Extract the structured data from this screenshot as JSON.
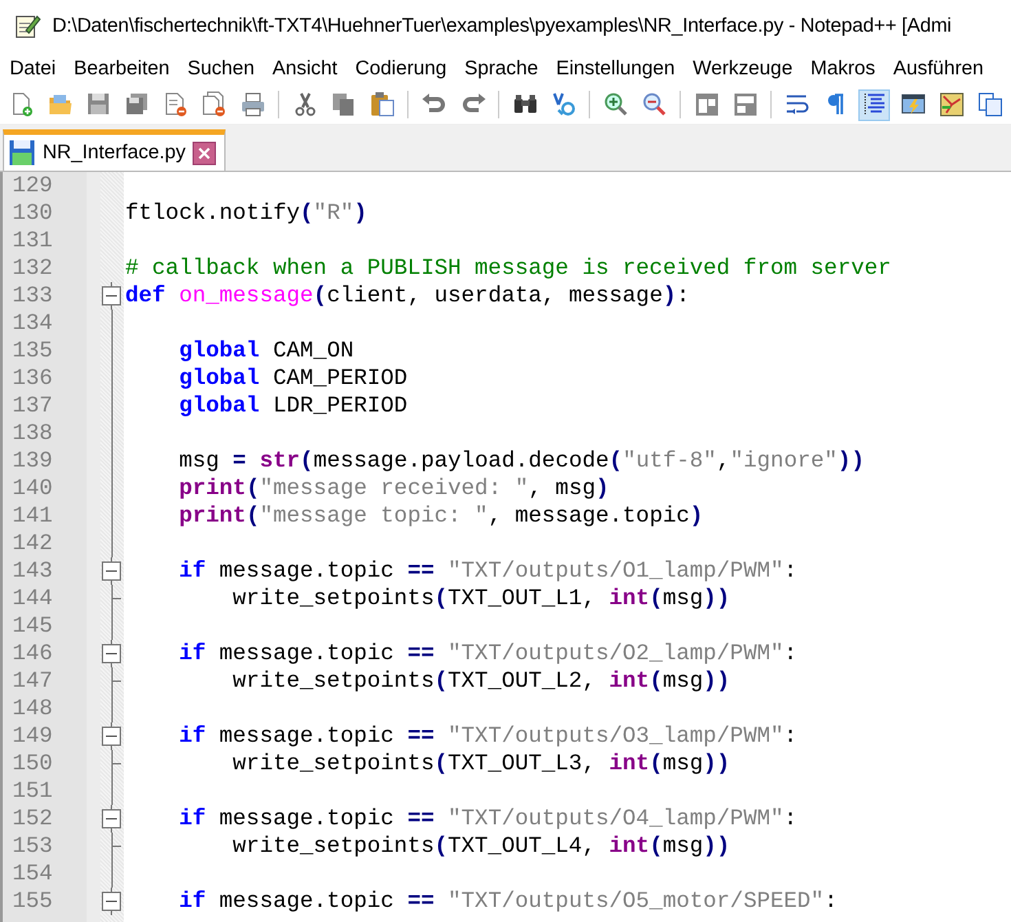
{
  "window": {
    "title": "D:\\Daten\\fischertechnik\\ft-TXT4\\HuehnerTuer\\examples\\pyexamples\\NR_Interface.py - Notepad++ [Admi"
  },
  "menu": [
    {
      "label": "Datei"
    },
    {
      "label": "Bearbeiten"
    },
    {
      "label": "Suchen"
    },
    {
      "label": "Ansicht"
    },
    {
      "label": "Codierung"
    },
    {
      "label": "Sprache"
    },
    {
      "label": "Einstellungen"
    },
    {
      "label": "Werkzeuge"
    },
    {
      "label": "Makros"
    },
    {
      "label": "Ausführen"
    }
  ],
  "tabs": [
    {
      "label": "NR_Interface.py",
      "selected": true
    }
  ],
  "editor": {
    "lines": [
      {
        "number": "129",
        "kind": "plain"
      },
      {
        "number": "130",
        "kind": "plain",
        "tokens": [
          {
            "kind": "text",
            "text": "ftlock.notify"
          },
          {
            "kind": "op",
            "text": "("
          },
          {
            "kind": "str",
            "text": "\"R\""
          },
          {
            "kind": "op",
            "text": ")"
          }
        ]
      },
      {
        "number": "131",
        "kind": "plain"
      },
      {
        "number": "132",
        "kind": "plain",
        "tokens": [
          {
            "kind": "comment",
            "text": "# callback when a PUBLISH message is received from server"
          }
        ]
      },
      {
        "number": "133",
        "kind": "foldstart",
        "tokens": [
          {
            "kind": "kw",
            "text": "def"
          },
          {
            "kind": "fn",
            "text": " on_message"
          },
          {
            "kind": "op",
            "text": "("
          },
          {
            "kind": "text",
            "text": "client, userdata, message"
          },
          {
            "kind": "op",
            "text": ")"
          },
          {
            "kind": "text",
            "text": ":"
          }
        ]
      },
      {
        "number": "134",
        "kind": "foldbody"
      },
      {
        "number": "135",
        "kind": "foldbody",
        "tokens": [
          {
            "kind": "kw",
            "text": "    global"
          },
          {
            "kind": "text",
            "text": " CAM_ON"
          }
        ]
      },
      {
        "number": "136",
        "kind": "foldbody",
        "tokens": [
          {
            "kind": "kw",
            "text": "    global"
          },
          {
            "kind": "text",
            "text": " CAM_PERIOD"
          }
        ]
      },
      {
        "number": "137",
        "kind": "foldbody",
        "tokens": [
          {
            "kind": "kw",
            "text": "    global"
          },
          {
            "kind": "text",
            "text": " LDR_PERIOD"
          }
        ]
      },
      {
        "number": "138",
        "kind": "foldbody"
      },
      {
        "number": "139",
        "kind": "foldbody",
        "tokens": [
          {
            "kind": "text",
            "text": "    msg "
          },
          {
            "kind": "op",
            "text": "="
          },
          {
            "kind": "builtin",
            "text": " str"
          },
          {
            "kind": "op",
            "text": "("
          },
          {
            "kind": "text",
            "text": "message.payload.decode"
          },
          {
            "kind": "op",
            "text": "("
          },
          {
            "kind": "str",
            "text": "\"utf-8\""
          },
          {
            "kind": "text",
            "text": ","
          },
          {
            "kind": "str",
            "text": "\"ignore\""
          },
          {
            "kind": "op",
            "text": "))"
          }
        ]
      },
      {
        "number": "140",
        "kind": "foldbody",
        "tokens": [
          {
            "kind": "builtin",
            "text": "    print"
          },
          {
            "kind": "op",
            "text": "("
          },
          {
            "kind": "str",
            "text": "\"message received: \""
          },
          {
            "kind": "text",
            "text": ", msg"
          },
          {
            "kind": "op",
            "text": ")"
          }
        ]
      },
      {
        "number": "141",
        "kind": "foldbody",
        "tokens": [
          {
            "kind": "builtin",
            "text": "    print"
          },
          {
            "kind": "op",
            "text": "("
          },
          {
            "kind": "str",
            "text": "\"message topic: \""
          },
          {
            "kind": "text",
            "text": ", message.topic"
          },
          {
            "kind": "op",
            "text": ")"
          }
        ]
      },
      {
        "number": "142",
        "kind": "foldbody"
      },
      {
        "number": "143",
        "kind": "foldstart",
        "tokens": [
          {
            "kind": "kw",
            "text": "    if"
          },
          {
            "kind": "text",
            "text": " message.topic "
          },
          {
            "kind": "op",
            "text": "=="
          },
          {
            "kind": "str",
            "text": " \"TXT/outputs/O1_lamp/PWM\""
          },
          {
            "kind": "text",
            "text": ":"
          }
        ]
      },
      {
        "number": "144",
        "kind": "foldend",
        "tokens": [
          {
            "kind": "text",
            "text": "        write_setpoints"
          },
          {
            "kind": "op",
            "text": "("
          },
          {
            "kind": "text",
            "text": "TXT_OUT_L1, "
          },
          {
            "kind": "builtin",
            "text": "int"
          },
          {
            "kind": "op",
            "text": "("
          },
          {
            "kind": "text",
            "text": "msg"
          },
          {
            "kind": "op",
            "text": "))"
          }
        ]
      },
      {
        "number": "145",
        "kind": "foldbody"
      },
      {
        "number": "146",
        "kind": "foldstart",
        "tokens": [
          {
            "kind": "kw",
            "text": "    if"
          },
          {
            "kind": "text",
            "text": " message.topic "
          },
          {
            "kind": "op",
            "text": "=="
          },
          {
            "kind": "str",
            "text": " \"TXT/outputs/O2_lamp/PWM\""
          },
          {
            "kind": "text",
            "text": ":"
          }
        ]
      },
      {
        "number": "147",
        "kind": "foldend",
        "tokens": [
          {
            "kind": "text",
            "text": "        write_setpoints"
          },
          {
            "kind": "op",
            "text": "("
          },
          {
            "kind": "text",
            "text": "TXT_OUT_L2, "
          },
          {
            "kind": "builtin",
            "text": "int"
          },
          {
            "kind": "op",
            "text": "("
          },
          {
            "kind": "text",
            "text": "msg"
          },
          {
            "kind": "op",
            "text": "))"
          }
        ]
      },
      {
        "number": "148",
        "kind": "foldbody"
      },
      {
        "number": "149",
        "kind": "foldstart",
        "tokens": [
          {
            "kind": "kw",
            "text": "    if"
          },
          {
            "kind": "text",
            "text": " message.topic "
          },
          {
            "kind": "op",
            "text": "=="
          },
          {
            "kind": "str",
            "text": " \"TXT/outputs/O3_lamp/PWM\""
          },
          {
            "kind": "text",
            "text": ":"
          }
        ]
      },
      {
        "number": "150",
        "kind": "foldend",
        "tokens": [
          {
            "kind": "text",
            "text": "        write_setpoints"
          },
          {
            "kind": "op",
            "text": "("
          },
          {
            "kind": "text",
            "text": "TXT_OUT_L3, "
          },
          {
            "kind": "builtin",
            "text": "int"
          },
          {
            "kind": "op",
            "text": "("
          },
          {
            "kind": "text",
            "text": "msg"
          },
          {
            "kind": "op",
            "text": "))"
          }
        ]
      },
      {
        "number": "151",
        "kind": "foldbody"
      },
      {
        "number": "152",
        "kind": "foldstart",
        "tokens": [
          {
            "kind": "kw",
            "text": "    if"
          },
          {
            "kind": "text",
            "text": " message.topic "
          },
          {
            "kind": "op",
            "text": "=="
          },
          {
            "kind": "str",
            "text": " \"TXT/outputs/O4_lamp/PWM\""
          },
          {
            "kind": "text",
            "text": ":"
          }
        ]
      },
      {
        "number": "153",
        "kind": "foldend",
        "tokens": [
          {
            "kind": "text",
            "text": "        write_setpoints"
          },
          {
            "kind": "op",
            "text": "("
          },
          {
            "kind": "text",
            "text": "TXT_OUT_L4, "
          },
          {
            "kind": "builtin",
            "text": "int"
          },
          {
            "kind": "op",
            "text": "("
          },
          {
            "kind": "text",
            "text": "msg"
          },
          {
            "kind": "op",
            "text": "))"
          }
        ]
      },
      {
        "number": "154",
        "kind": "foldbody"
      },
      {
        "number": "155",
        "kind": "foldstart",
        "tokens": [
          {
            "kind": "kw",
            "text": "    if"
          },
          {
            "kind": "text",
            "text": " message.topic "
          },
          {
            "kind": "op",
            "text": "=="
          },
          {
            "kind": "str",
            "text": " \"TXT/outputs/O5_motor/SPEED\""
          },
          {
            "kind": "text",
            "text": ":"
          }
        ]
      }
    ]
  }
}
